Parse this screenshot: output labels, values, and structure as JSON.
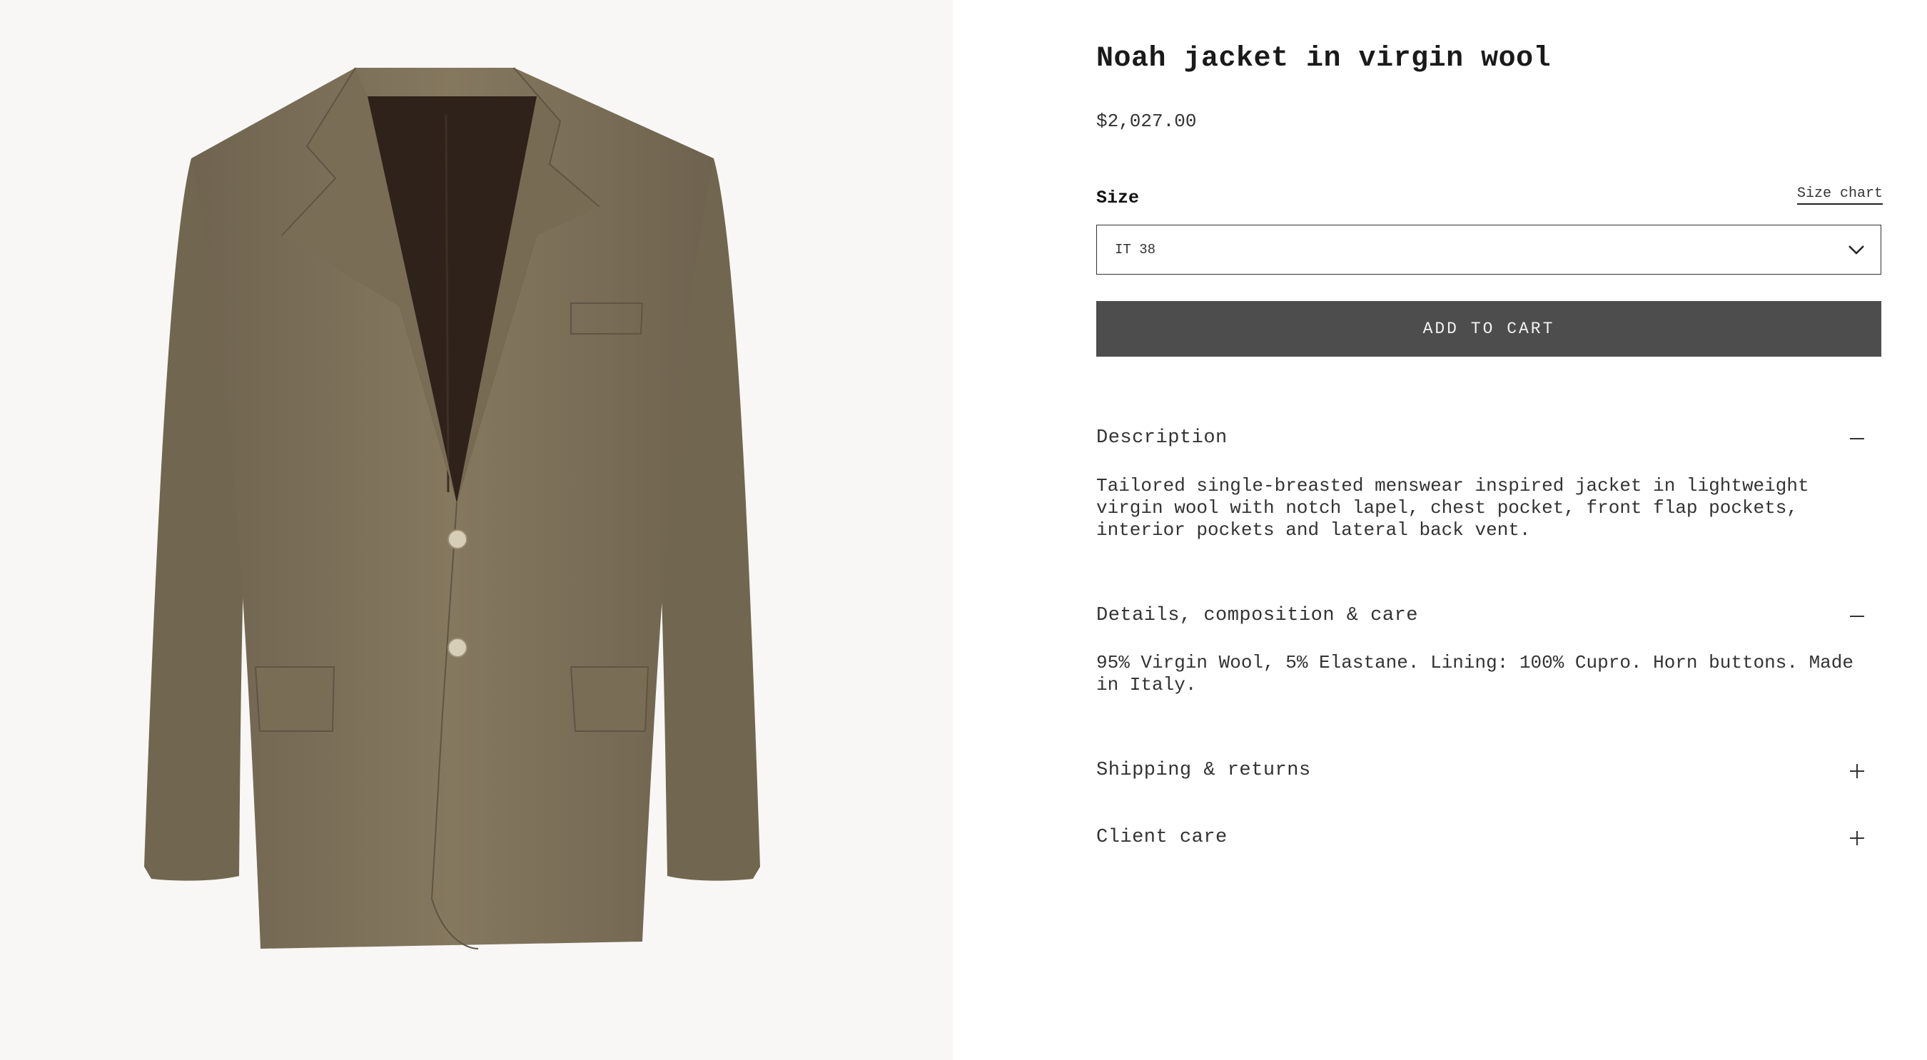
{
  "product": {
    "title": "Noah jacket in virgin wool",
    "price": "$2,027.00",
    "image_icon": "jacket-image"
  },
  "size": {
    "label": "Size",
    "chart_link": "Size chart",
    "selected": "IT 38"
  },
  "add_to_cart": "ADD TO CART",
  "accordions": [
    {
      "title": "Description",
      "expanded": true,
      "body": "Tailored single-breasted menswear inspired jacket in lightweight virgin wool with notch lapel, chest pocket, front flap pockets, interior pockets and lateral back vent."
    },
    {
      "title": "Details, composition & care",
      "expanded": true,
      "body": "95% Virgin Wool, 5% Elastane. Lining: 100% Cupro. Horn buttons. Made in Italy."
    },
    {
      "title": "Shipping & returns",
      "expanded": false
    },
    {
      "title": "Client care",
      "expanded": false
    }
  ],
  "colors": {
    "gallery_bg": "#f8f7f5",
    "jacket": "#7d7059",
    "lining": "#2f221a",
    "button_bg": "#4d4d4d"
  }
}
